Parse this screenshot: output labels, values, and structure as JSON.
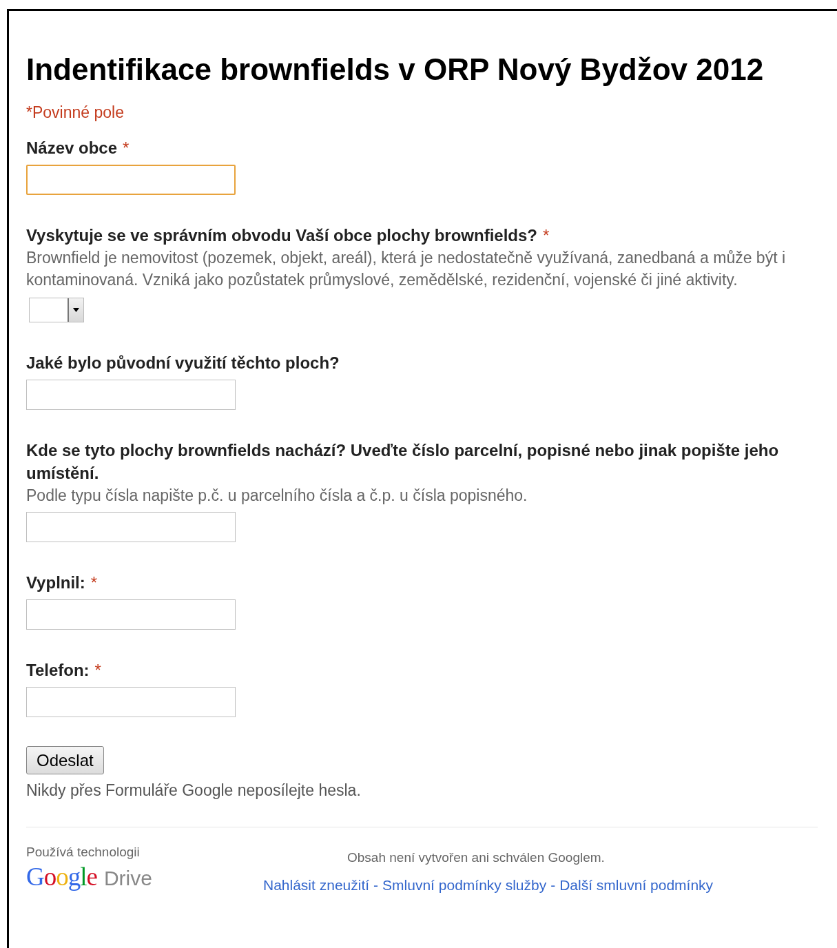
{
  "form_title": "Indentifikace brownfields v ORP Nový Bydžov 2012",
  "required_note": "*Povinné pole",
  "questions": [
    {
      "kind": "text",
      "label": "Název obce",
      "required": true,
      "focused": true
    },
    {
      "kind": "select",
      "label": "Vyskytuje se ve správním obvodu Vaší obce plochy brownfields?",
      "required": true,
      "help": "Brownfield je nemovitost (pozemek, objekt, areál), která je nedostatečně využívaná, zanedbaná a může být i kontaminovaná. Vzniká jako pozůstatek průmyslové, zemědělské, rezidenční, vojenské či jiné aktivity."
    },
    {
      "kind": "text",
      "label": "Jaké bylo původní využití těchto ploch?",
      "required": false,
      "focused": false
    },
    {
      "kind": "text",
      "label": "Kde se tyto plochy brownfields nachází? Uveďte číslo parcelní, popisné nebo jinak popište jeho umístění.",
      "required": false,
      "help": "Podle typu čísla napište p.č. u parcelního čísla a č.p. u čísla popisného.",
      "focused": false
    },
    {
      "kind": "text",
      "label": "Vyplnil:",
      "required": true,
      "focused": false
    },
    {
      "kind": "text",
      "label": "Telefon:",
      "required": true,
      "focused": false
    }
  ],
  "required_mark": "*",
  "submit_button": "Odeslat",
  "password_warning": "Nikdy přes Formuláře Google neposílejte hesla.",
  "footer": {
    "powered_by": "Používá technologii",
    "logo_google": "Google",
    "logo_product": "Drive",
    "disclaimer": "Obsah není vytvořen ani schválen Googlem.",
    "links": [
      "Nahlásit zneužití",
      "Smluvní podmínky služby",
      "Další smluvní podmínky"
    ],
    "separator": "-"
  }
}
